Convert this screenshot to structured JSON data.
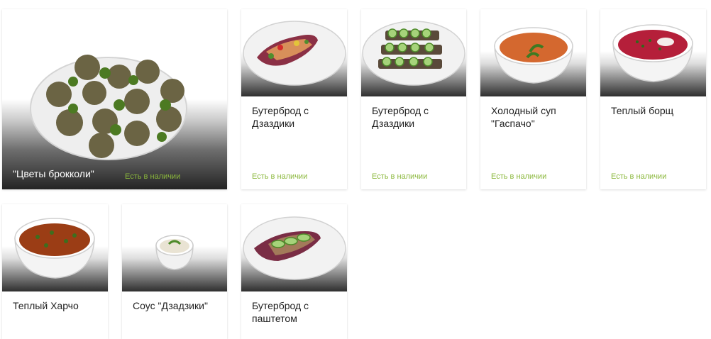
{
  "products": [
    {
      "title": "\"Цветы брокколи\"",
      "status": "Есть в наличии",
      "image": "broccoli-flowers-photo"
    },
    {
      "title": "Бутерброд с Дзаздики",
      "status": "Есть в наличии",
      "image": "sandwich-tzatziki-photo"
    },
    {
      "title": "Бутерброд с Дзаздики",
      "status": "Есть в наличии",
      "image": "cucumber-sandwiches-photo"
    },
    {
      "title": "Холодный суп \"Гаспачо\"",
      "status": "Есть в наличии",
      "image": "gazpacho-bowl-photo"
    },
    {
      "title": "Теплый борщ",
      "status": "Есть в наличии",
      "image": "borscht-bowl-photo"
    },
    {
      "title": "Теплый Харчо",
      "status": "",
      "image": "kharcho-bowl-photo"
    },
    {
      "title": "Соус \"Дзадзики\"",
      "status": "",
      "image": "tzatziki-sauce-photo"
    },
    {
      "title": "Бутерброд с паштетом",
      "status": "",
      "image": "pate-sandwich-photo"
    }
  ],
  "colors": {
    "in_stock": "#8bb83c",
    "title": "#222222",
    "card_bg": "#ffffff"
  }
}
